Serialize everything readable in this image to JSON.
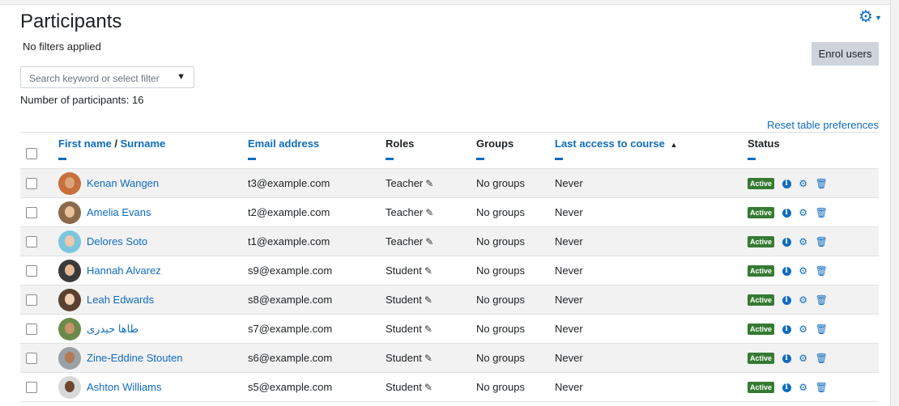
{
  "page": {
    "title": "Participants",
    "filters_status": "No filters applied",
    "enrol_label": "Enrol users",
    "search_placeholder": "Search keyword or select filter",
    "participant_count": "Number of participants: 16",
    "reset_label": "Reset table preferences"
  },
  "columns": {
    "first_name": "First name",
    "separator": "/",
    "surname": "Surname",
    "email": "Email address",
    "roles": "Roles",
    "groups": "Groups",
    "last_access": "Last access to course",
    "status": "Status"
  },
  "colors": {
    "link": "#0f6cbf",
    "active_badge": "#357a32",
    "row_stripe": "#f2f2f2"
  },
  "rows": [
    {
      "name": "Kenan Wangen",
      "email": "t3@example.com",
      "role": "Teacher",
      "groups": "No groups",
      "access": "Never",
      "status": "Active",
      "avatar_bg": "#c86f3c",
      "skin": "#d9a47a"
    },
    {
      "name": "Amelia Evans",
      "email": "t2@example.com",
      "role": "Teacher",
      "groups": "No groups",
      "access": "Never",
      "status": "Active",
      "avatar_bg": "#8a6a4a",
      "skin": "#e8c09a"
    },
    {
      "name": "Delores Soto",
      "email": "t1@example.com",
      "role": "Teacher",
      "groups": "No groups",
      "access": "Never",
      "status": "Active",
      "avatar_bg": "#7cc6e0",
      "skin": "#f0c9a8"
    },
    {
      "name": "Hannah Alvarez",
      "email": "s9@example.com",
      "role": "Student",
      "groups": "No groups",
      "access": "Never",
      "status": "Active",
      "avatar_bg": "#3a3a3a",
      "skin": "#e4b997"
    },
    {
      "name": "Leah Edwards",
      "email": "s8@example.com",
      "role": "Student",
      "groups": "No groups",
      "access": "Never",
      "status": "Active",
      "avatar_bg": "#5a4030",
      "skin": "#edd0b5"
    },
    {
      "name": "طاها حيدری",
      "email": "s7@example.com",
      "role": "Student",
      "groups": "No groups",
      "access": "Never",
      "status": "Active",
      "avatar_bg": "#6b8a4a",
      "skin": "#c9946a"
    },
    {
      "name": "Zine-Eddine Stouten",
      "email": "s6@example.com",
      "role": "Student",
      "groups": "No groups",
      "access": "Never",
      "status": "Active",
      "avatar_bg": "#9aa0a6",
      "skin": "#b27a55"
    },
    {
      "name": "Ashton Williams",
      "email": "s5@example.com",
      "role": "Student",
      "groups": "No groups",
      "access": "Never",
      "status": "Active",
      "avatar_bg": "#d8d8d8",
      "skin": "#6e4630"
    }
  ]
}
